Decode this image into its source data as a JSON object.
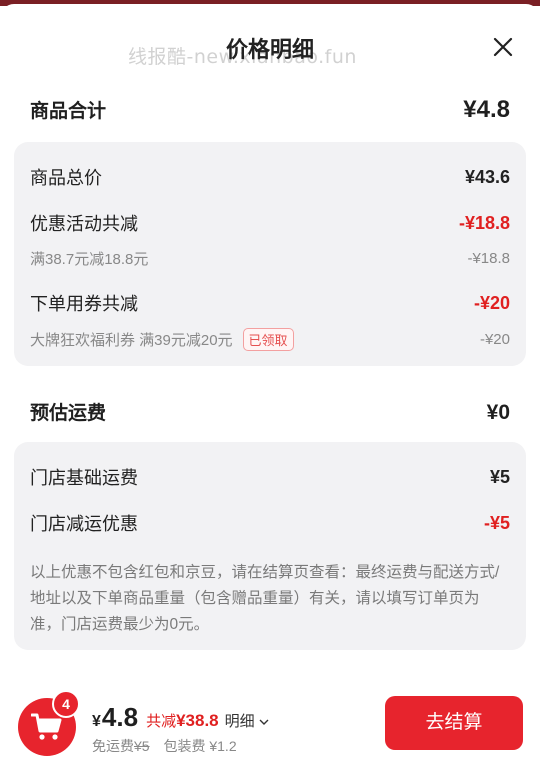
{
  "watermark": "线报酷-new.xianbao.fun",
  "title": "价格明细",
  "goods": {
    "label": "商品合计",
    "total": "¥4.8",
    "lines": {
      "original_label": "商品总价",
      "original_value": "¥43.6",
      "promo_label": "优惠活动共减",
      "promo_value": "-¥18.8",
      "promo_sub_label": "满38.7元减18.8元",
      "promo_sub_value": "-¥18.8",
      "coupon_label": "下单用券共减",
      "coupon_value": "-¥20",
      "coupon_sub_label": "大牌狂欢福利券 满39元减20元",
      "coupon_badge": "已领取",
      "coupon_sub_value": "-¥20"
    }
  },
  "shipping": {
    "label": "预估运费",
    "total": "¥0",
    "base_label": "门店基础运费",
    "base_value": "¥5",
    "discount_label": "门店减运优惠",
    "discount_value": "-¥5",
    "note": "以上优惠不包含红包和京豆，请在结算页查看：最终运费与配送方式/地址以及下单商品重量（包含赠品重量）有关，请以填写订单页为准，门店运费最少为0元。"
  },
  "footer": {
    "cart_count": "4",
    "currency": "¥",
    "total": "4.8",
    "save_prefix": "共减",
    "save_value": "¥38.8",
    "detail_label": "明细",
    "free_shipping_label": "免运费",
    "free_shipping_original": "¥5",
    "packing_label": "包装费 ¥1.2",
    "checkout_label": "去结算"
  },
  "colors": {
    "accent": "#e7242d",
    "discount_red": "#e02020",
    "card_bg": "#f2f2f4"
  },
  "icons": {
    "close": "close-icon",
    "cart": "cart-icon",
    "chevron": "chevron-down-icon"
  }
}
